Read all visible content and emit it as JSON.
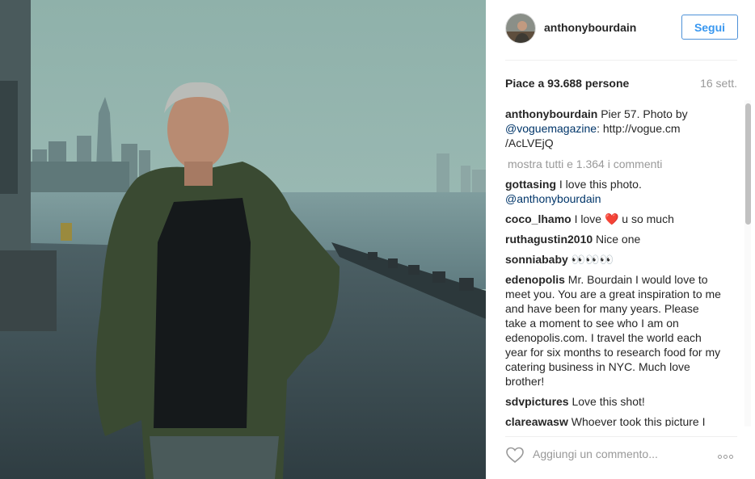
{
  "post": {
    "username": "anthonybourdain",
    "follow_label": "Segui",
    "likes_text": "Piace a 93.688 persone",
    "date_text": "16 sett.",
    "caption": {
      "user": "anthonybourdain",
      "text_1": " Pier 57. Photo by ",
      "mention": "@voguemagazine",
      "text_2": ": http://vogue.cm /AcLVEjQ"
    },
    "show_all_comments": "mostra tutti e 1.364 i commenti",
    "comments": [
      {
        "user": "gottasing",
        "text": " I love this photo. ",
        "mention": "@anthonybourdain"
      },
      {
        "user": "coco_lhamo",
        "text_1": " I love ",
        "emoji": "❤️",
        "text_2": " u so much"
      },
      {
        "user": "ruthagustin2010",
        "text": " Nice one"
      },
      {
        "user": "sonniababy",
        "text": " 👀👀👀"
      },
      {
        "user": "edenopolis",
        "text": " Mr. Bourdain I would love to meet you. You are a great inspiration to me and have been for many years. Please take a moment to see who I am on edenopolis.com. I travel the world each year for six months to research food for my catering business in NYC. Much love brother!"
      },
      {
        "user": "sdvpictures",
        "text": " Love this shot!"
      },
      {
        "user": "clareawasw",
        "text": " Whoever took this picture I"
      }
    ],
    "add_comment_placeholder": "Aggiungi un commento...",
    "icons": {
      "heart": "heart-outline-icon",
      "more": "more-options-icon"
    },
    "colors": {
      "follow_accent": "#3897f0",
      "secondary_text": "#999999"
    }
  }
}
